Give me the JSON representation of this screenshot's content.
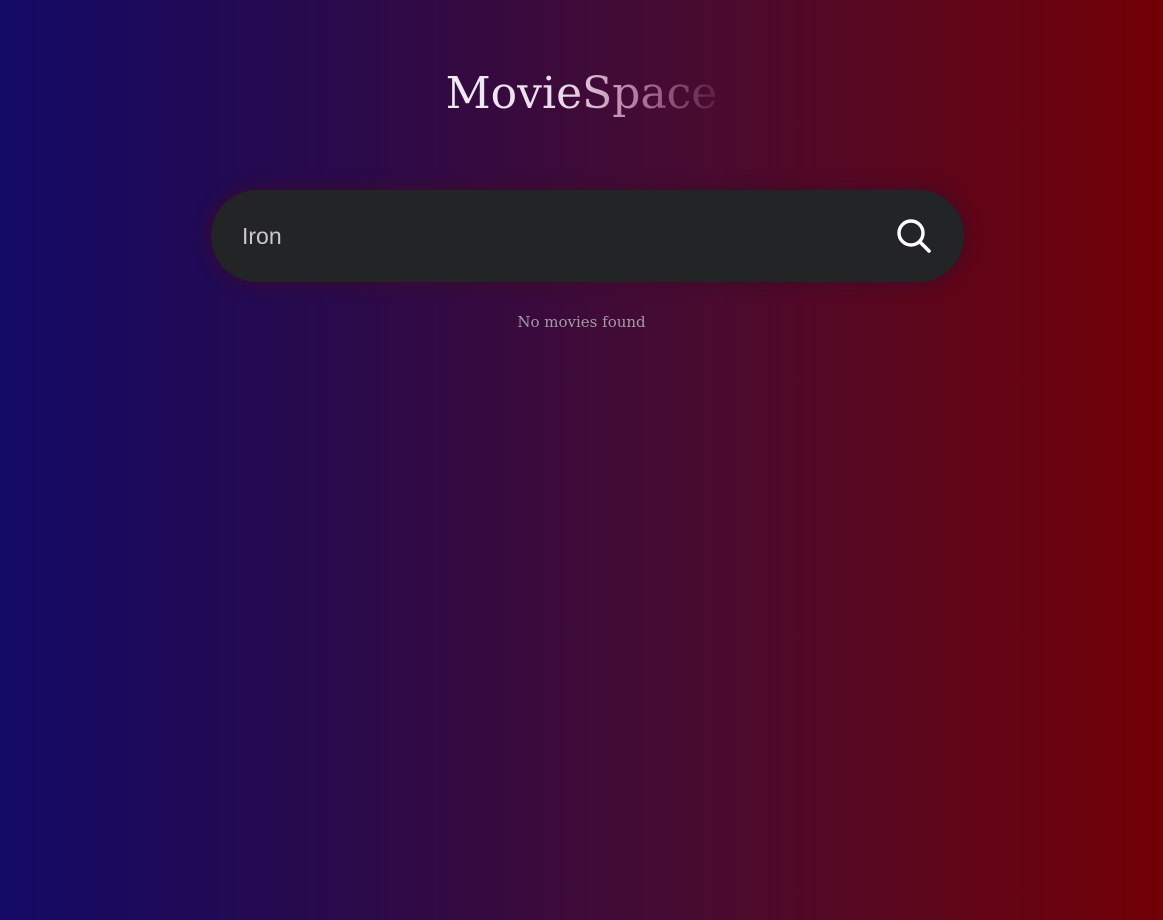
{
  "header": {
    "title": "MovieSpace"
  },
  "search": {
    "value": "Iron",
    "button_icon": "search-icon"
  },
  "results": {
    "status_text": "No movies found"
  },
  "colors": {
    "gradient_left": "#130a66",
    "gradient_right": "#720005",
    "search_bar_bg": "#222426"
  }
}
